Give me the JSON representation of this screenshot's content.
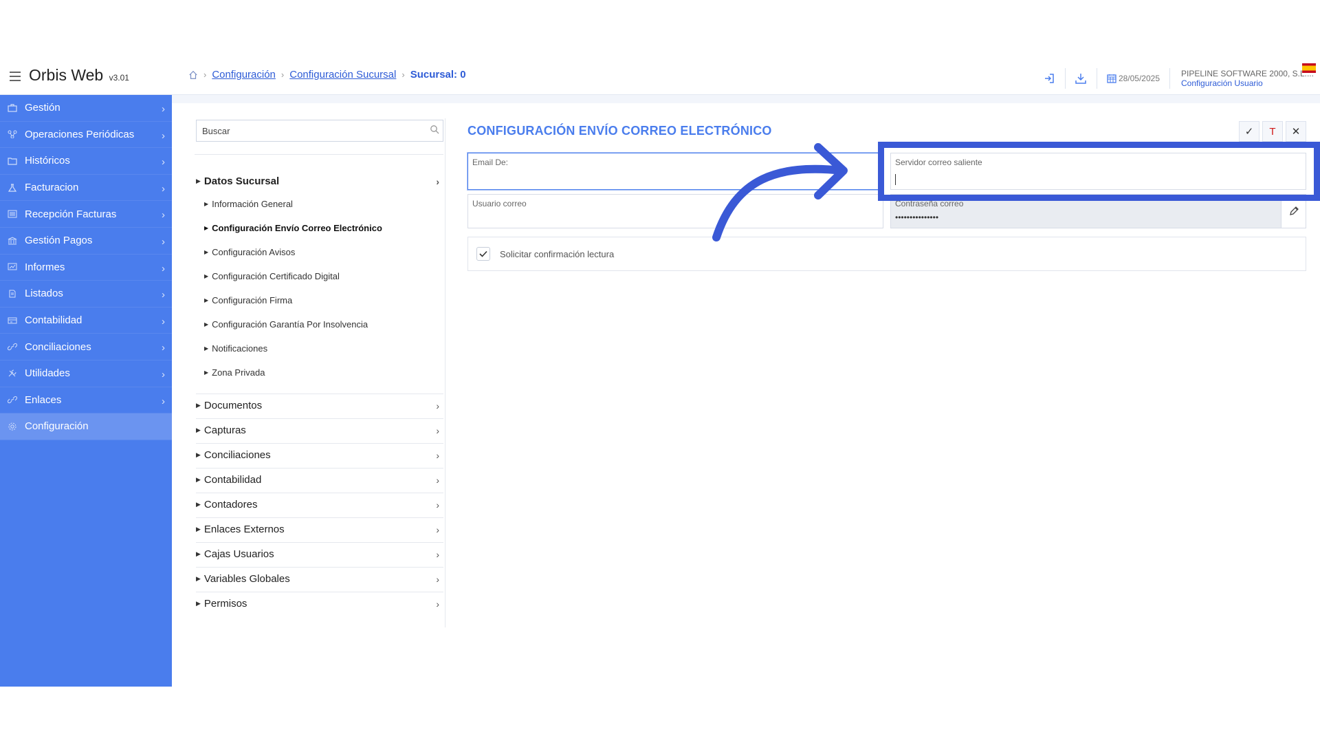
{
  "app": {
    "title": "Orbis Web",
    "version": "v3.01"
  },
  "breadcrumb": {
    "items": [
      "Configuración",
      "Configuración Sucursal"
    ],
    "current": "Sucursal: 0"
  },
  "header": {
    "date": "28/05/2025",
    "company": "PIPELINE SOFTWARE 2000, S.L....",
    "user_config": "Configuración Usuario",
    "flag": "spain-flag"
  },
  "sidebar": {
    "items": [
      {
        "label": "Gestión",
        "icon": "briefcase-icon"
      },
      {
        "label": "Operaciones Periódicas",
        "icon": "network-icon"
      },
      {
        "label": "Históricos",
        "icon": "folder-icon"
      },
      {
        "label": "Facturacion",
        "icon": "flask-icon"
      },
      {
        "label": "Recepción Facturas",
        "icon": "list-icon"
      },
      {
        "label": "Gestión Pagos",
        "icon": "bank-icon"
      },
      {
        "label": "Informes",
        "icon": "report-icon"
      },
      {
        "label": "Listados",
        "icon": "document-icon"
      },
      {
        "label": "Contabilidad",
        "icon": "ledger-icon"
      },
      {
        "label": "Conciliaciones",
        "icon": "link-icon"
      },
      {
        "label": "Utilidades",
        "icon": "tools-icon"
      },
      {
        "label": "Enlaces",
        "icon": "link-icon"
      },
      {
        "label": "Configuración",
        "icon": "gear-icon"
      }
    ]
  },
  "tree": {
    "search_placeholder": "Buscar",
    "group_open": "Datos Sucursal",
    "sub_items": [
      "Información General",
      "Configuración Envío Correo Electrónico",
      "Configuración Avisos",
      "Configuración Certificado Digital",
      "Configuración Firma",
      "Configuración Garantía Por Insolvencia",
      "Notificaciones",
      "Zona Privada"
    ],
    "groups": [
      "Documentos",
      "Capturas",
      "Conciliaciones",
      "Contabilidad",
      "Contadores",
      "Enlaces Externos",
      "Cajas Usuarios",
      "Variables Globales",
      "Permisos"
    ]
  },
  "form": {
    "title": "CONFIGURACIÓN ENVÍO CORREO ELECTRÓNICO",
    "actions": {
      "confirm": "✓",
      "t": "T",
      "close": "✕"
    },
    "fields": {
      "email_de": {
        "label": "Email De:",
        "value": ""
      },
      "servidor": {
        "label": "Servidor correo saliente",
        "value": ""
      },
      "usuario": {
        "label": "Usuario correo",
        "value": ""
      },
      "contrasena": {
        "label": "Contraseña correo",
        "value": "•••••••••••••••"
      }
    },
    "checkbox": {
      "label": "Solicitar confirmación lectura",
      "checked": true
    }
  },
  "colors": {
    "accent": "#4a7ded",
    "annotation": "#3a59d6"
  }
}
